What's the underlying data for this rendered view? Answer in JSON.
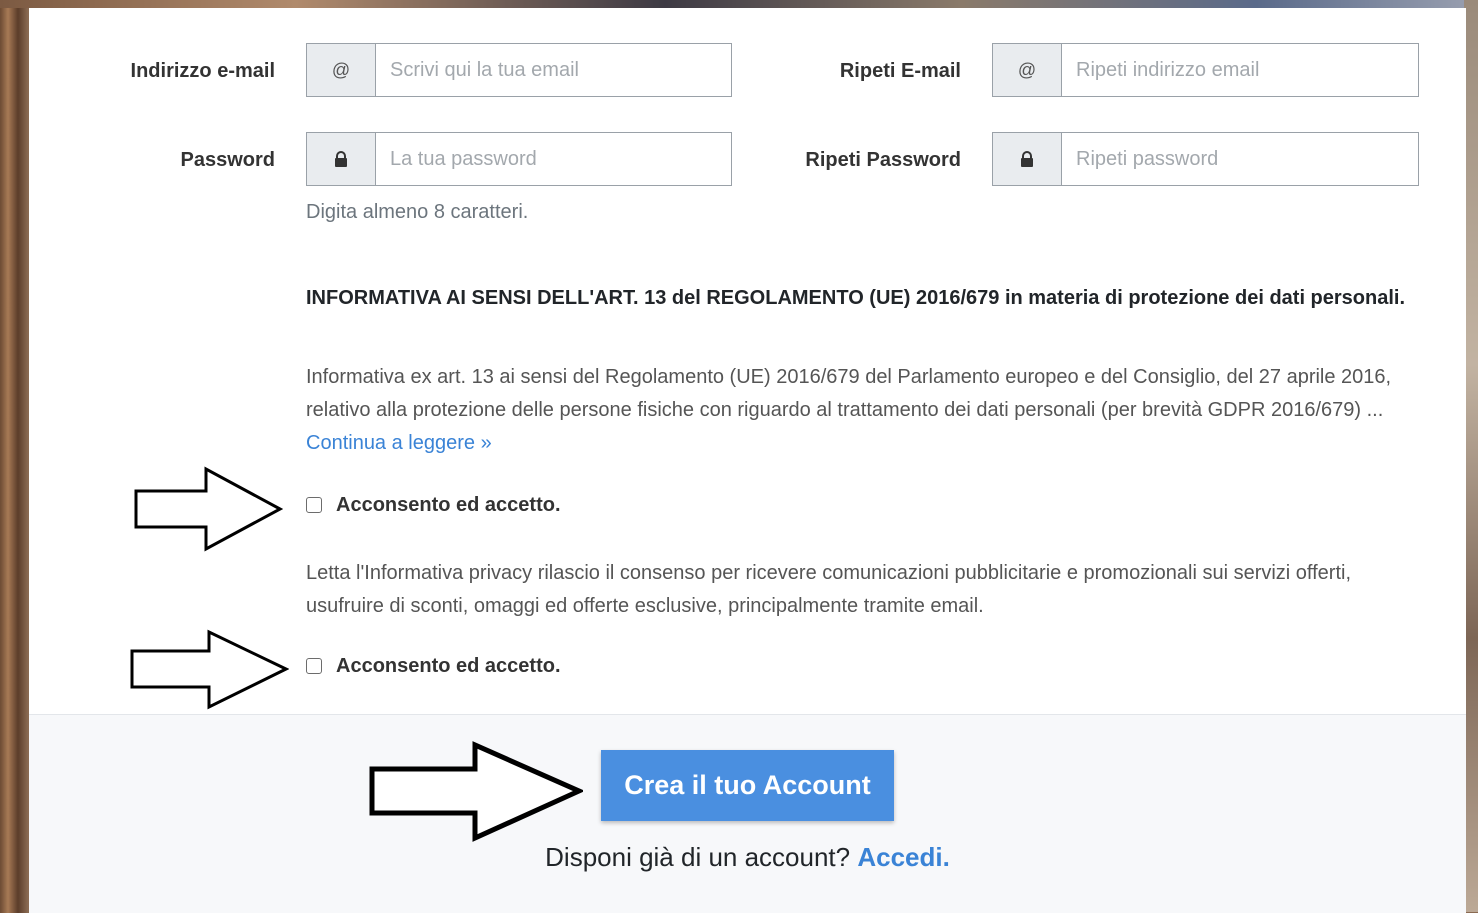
{
  "email_row": {
    "label": "Indirizzo e-mail",
    "addon": "@",
    "placeholder": "Scrivi qui la tua email",
    "repeat_label": "Ripeti E-mail",
    "repeat_addon": "@",
    "repeat_placeholder": "Ripeti indirizzo email"
  },
  "password_row": {
    "label": "Password",
    "addon_icon": "lock-icon",
    "placeholder": "La tua password",
    "repeat_label": "Ripeti Password",
    "repeat_addon_icon": "lock-icon",
    "repeat_placeholder": "Ripeti password",
    "hint": "Digita almeno 8 caratteri."
  },
  "privacy": {
    "title": "INFORMATIVA AI SENSI DELL'ART. 13 del REGOLAMENTO (UE) 2016/679 in materia di protezione dei dati personali.",
    "text": "Informativa ex art. 13 ai sensi del Regolamento (UE) 2016/679 del Parlamento europeo e del Consiglio, del 27 aprile 2016, relativo alla protezione delle persone fisiche con riguardo al trattamento dei dati personali (per brevità GDPR 2016/679) ... ",
    "read_more": "Continua a leggere »",
    "consent_label": "Acconsento ed accetto."
  },
  "marketing": {
    "text": "Letta l'Informativa privacy rilascio il consenso per ricevere comunicazioni pubblicitarie e promozionali sui servizi offerti, usufruire di sconti, omaggi ed offerte esclusive, principalmente tramite email.",
    "consent_label": "Acconsento ed accetto."
  },
  "footer": {
    "submit_label": "Crea il tuo Account",
    "login_prompt": "Disponi già di un account? ",
    "login_link": "Accedi."
  },
  "colors": {
    "accent": "#4a8fe0",
    "link": "#3a83d6",
    "addon_bg": "#e9ecef"
  }
}
